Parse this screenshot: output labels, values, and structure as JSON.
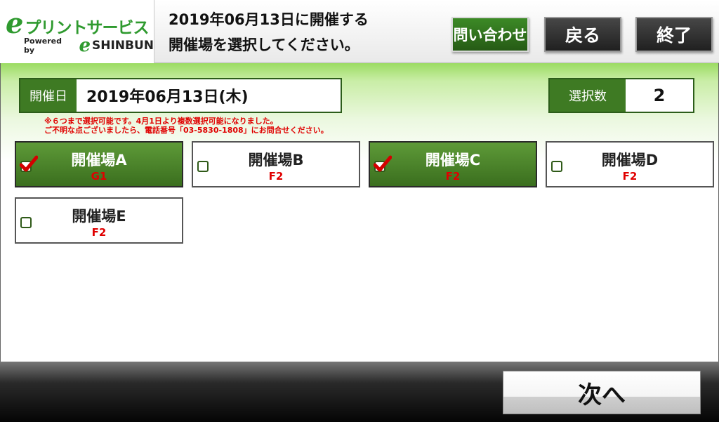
{
  "header": {
    "logo": {
      "main_text": "プリントサービス",
      "powered_by": "Powered by",
      "shinbun": "SHINBUN"
    },
    "title_line1": "2019年06月13日に開催する",
    "title_line2": "開催場を選択してください。",
    "inquiry_label": "問い合わせ",
    "back_label": "戻る",
    "end_label": "終了"
  },
  "date": {
    "label": "開催日",
    "value": "2019年06月13日(木)"
  },
  "selection": {
    "label": "選択数",
    "value": "2"
  },
  "notice": {
    "line1": "※６つまで選択可能です。4月1日より複数選択可能になりました。",
    "line2": "ご不明な点ございましたら、電話番号「03-5830-1808」にお問合せください。"
  },
  "venues": [
    {
      "name": "開催場A",
      "grade": "G1",
      "selected": true
    },
    {
      "name": "開催場B",
      "grade": "F2",
      "selected": false
    },
    {
      "name": "開催場C",
      "grade": "F2",
      "selected": true
    },
    {
      "name": "開催場D",
      "grade": "F2",
      "selected": false
    },
    {
      "name": "開催場E",
      "grade": "F2",
      "selected": false
    }
  ],
  "footer": {
    "next_label": "次へ"
  },
  "colors": {
    "brand_green": "#2f9a2f",
    "accent_red": "#e00000",
    "panel_green": "#3e7a23"
  }
}
